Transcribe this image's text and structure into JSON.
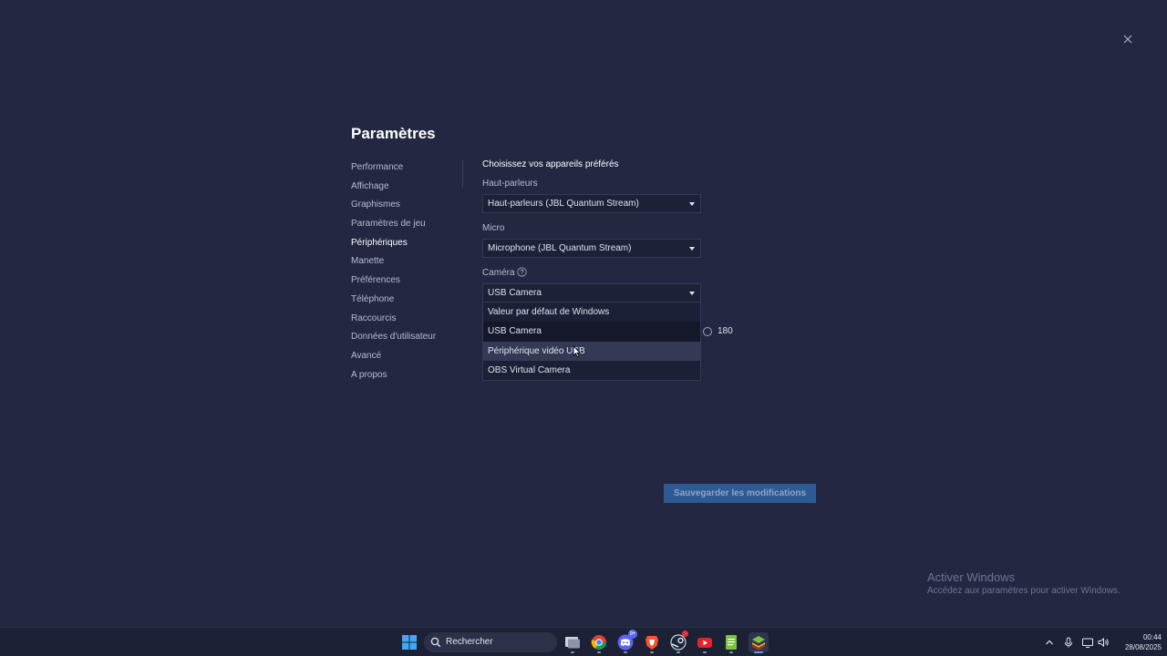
{
  "dialog": {
    "title": "Paramètres"
  },
  "nav": {
    "items": [
      {
        "label": "Performance"
      },
      {
        "label": "Affichage"
      },
      {
        "label": "Graphismes"
      },
      {
        "label": "Paramètres de jeu"
      },
      {
        "label": "Périphériques",
        "active": true
      },
      {
        "label": "Manette"
      },
      {
        "label": "Préférences"
      },
      {
        "label": "Téléphone"
      },
      {
        "label": "Raccourcis"
      },
      {
        "label": "Données d'utilisateur"
      },
      {
        "label": "Avancé"
      },
      {
        "label": "A propos"
      }
    ]
  },
  "devices": {
    "heading": "Choisissez vos appareils préférés",
    "speakers": {
      "label": "Haut-parleurs",
      "value": "Haut-parleurs (JBL Quantum Stream)"
    },
    "micro": {
      "label": "Micro",
      "value": "Microphone (JBL Quantum Stream)"
    },
    "camera": {
      "label": "Caméra",
      "value": "USB Camera",
      "options": [
        {
          "label": "Valeur par défaut de Windows"
        },
        {
          "label": "USB Camera",
          "selected": true
        },
        {
          "label": "Périphérique vidéo USB",
          "hovered": true
        },
        {
          "label": "OBS Virtual Camera"
        }
      ]
    },
    "rotation_option_label": "180"
  },
  "save_button": {
    "label": "Sauvegarder les modifications"
  },
  "watermark": {
    "title": "Activer Windows",
    "subtitle": "Accédez aux paramètres pour activer Windows."
  },
  "taskbar": {
    "search_placeholder": "Rechercher",
    "clock_time": "00:44",
    "clock_date": "28/08/2025",
    "discord_badge": "9+",
    "apps": [
      "windows-start-icon",
      "search-icon",
      "file-explorer-icon",
      "chrome-icon",
      "discord-icon",
      "brave-icon",
      "steam-icon",
      "youtube-icon",
      "notepad-icon",
      "bluestacks-icon"
    ]
  },
  "colors": {
    "background": "#232742",
    "accent_button": "#2e5a94",
    "text_primary": "#ffffff",
    "text_secondary": "#b7bcd4"
  }
}
